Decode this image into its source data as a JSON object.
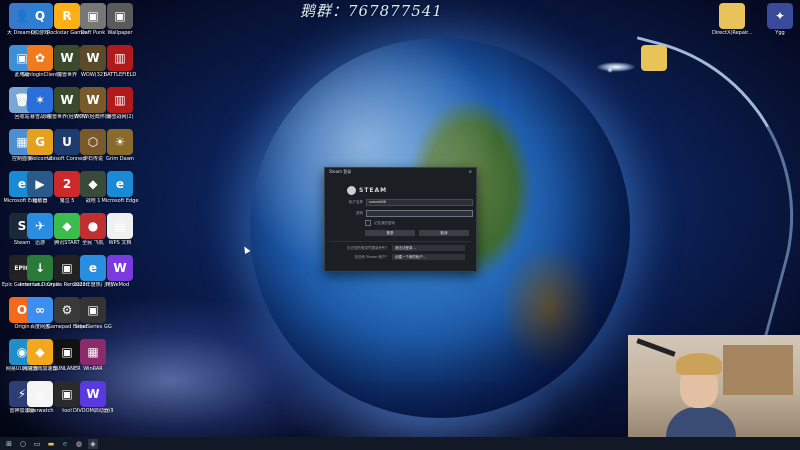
{
  "watermark": "鹅群：767877541",
  "desktop_icons_left": [
    {
      "label": "大 Dream(s)",
      "color": "#3a78c9",
      "glyph": "👤",
      "icon": "user-folder-icon"
    },
    {
      "label": "此电脑",
      "color": "#3f8fd8",
      "glyph": "▣",
      "icon": "computer-icon"
    },
    {
      "label": "回收站",
      "color": "#7aa6d6",
      "glyph": "🗑",
      "icon": "recycle-bin-icon"
    },
    {
      "label": "控制面板",
      "color": "#4d8fd0",
      "glyph": "▦",
      "icon": "control-panel-icon"
    },
    {
      "label": "Microsoft Edge",
      "color": "#1a8ad4",
      "glyph": "e",
      "icon": "edge-icon"
    },
    {
      "label": "Steam",
      "color": "#1b2838",
      "glyph": "S",
      "icon": "steam-icon"
    },
    {
      "label": "Epic Games Launcher",
      "color": "#222",
      "glyph": "EPIC",
      "icon": "epic-icon"
    },
    {
      "label": "Origin",
      "color": "#f26a1b",
      "glyph": "O",
      "icon": "origin-icon"
    },
    {
      "label": "网易UU加速器",
      "color": "#1f8ec9",
      "glyph": "◉",
      "icon": "uu-icon"
    },
    {
      "label": "雷神加速器",
      "color": "#2c3e73",
      "glyph": "⚡",
      "icon": "leishen-icon"
    }
  ],
  "desktop_icons_col2": [
    {
      "label": "QQ游戏",
      "color": "#2d7ed0",
      "glyph": "Q",
      "icon": "qq-game-icon"
    },
    {
      "label": "SunloginClient",
      "color": "#f07a1c",
      "glyph": "✿",
      "icon": "sunlogin-icon"
    },
    {
      "label": "暴雪战网",
      "color": "#2a6fd9",
      "glyph": "✶",
      "icon": "battlenet-icon"
    },
    {
      "label": "Welcome",
      "color": "#e5a020",
      "glyph": "G",
      "icon": "gog-icon"
    },
    {
      "label": "播放器",
      "color": "#2a5a8a",
      "glyph": "▶",
      "icon": "player-icon"
    },
    {
      "label": "迅游",
      "color": "#2a8ee0",
      "glyph": "✈",
      "icon": "xunyou-icon"
    },
    {
      "label": "Internet Downlo...",
      "color": "#2a7a3a",
      "glyph": "↓",
      "icon": "idm-icon"
    },
    {
      "label": "百度网盘",
      "color": "#3c8ff0",
      "glyph": "∞",
      "icon": "baidu-netdisk-icon"
    },
    {
      "label": "网易游戏加速器",
      "color": "#f4a71d",
      "glyph": "◆",
      "icon": "netease-boost-icon"
    },
    {
      "label": "Overwatch",
      "color": "#f5f5f5",
      "glyph": "◎",
      "icon": "overwatch-icon"
    }
  ],
  "desktop_icons_col3": [
    {
      "label": "Rockstar Games Launcher",
      "color": "#fcaf17",
      "glyph": "R",
      "icon": "rockstar-icon"
    },
    {
      "label": "魔兽世界",
      "color": "#3b4a2c",
      "glyph": "W",
      "icon": "wow-icon"
    },
    {
      "label": "魔兽世界(经典怀旧服)",
      "color": "#3b4a2c",
      "glyph": "W",
      "icon": "wow-classic-icon"
    },
    {
      "label": "Ubisoft Connect",
      "color": "#1e3b6e",
      "glyph": "U",
      "icon": "ubisoft-icon"
    },
    {
      "label": "鬼泣 5",
      "color": "#cc2a2a",
      "glyph": "2",
      "icon": "game-2-icon"
    },
    {
      "label": "腾讯START",
      "color": "#3dbb4f",
      "glyph": "◆",
      "icon": "start-icon"
    },
    {
      "label": "Crysis Remastered",
      "color": "#222",
      "glyph": "▣",
      "icon": "game-icon"
    },
    {
      "label": "Gamepad Helper",
      "color": "#3a3a3a",
      "glyph": "⚙",
      "icon": "gamepad-icon"
    },
    {
      "label": "SUNLANER",
      "color": "#111",
      "glyph": "▣",
      "icon": "sunlaner-icon"
    },
    {
      "label": "tool",
      "color": "#2a2a2a",
      "glyph": "▣",
      "icon": "tool-icon"
    }
  ],
  "desktop_icons_col4": [
    {
      "label": "Daft Punk",
      "color": "#777",
      "glyph": "▣",
      "icon": "photo-icon"
    },
    {
      "label": "WOW(32)",
      "color": "#5a4a2a",
      "glyph": "W",
      "icon": "wow-32-icon"
    },
    {
      "label": "WOW(经典怀旧)",
      "color": "#7a5a2a",
      "glyph": "W",
      "icon": "wow-classic-2-icon"
    },
    {
      "label": "炉石传说",
      "color": "#7a5a2a",
      "glyph": "⬡",
      "icon": "hearthstone-icon"
    },
    {
      "label": "战地 1",
      "color": "#3a4a3a",
      "glyph": "◆",
      "icon": "battlefield-icon"
    },
    {
      "label": "全民 飞机",
      "color": "#c03030",
      "glyph": "●",
      "icon": "game-3-icon"
    },
    {
      "label": "2023年度热门精选",
      "color": "#2a8ee0",
      "glyph": "e",
      "icon": "edge-2-icon"
    },
    {
      "label": "SteelSeries GG",
      "color": "#333",
      "glyph": "▣",
      "icon": "steelseries-icon"
    },
    {
      "label": "WinRAR",
      "color": "#8a2a6a",
      "glyph": "▦",
      "icon": "winrar-icon"
    },
    {
      "label": "DIVOOM启动器(新)",
      "color": "#5a3ae0",
      "glyph": "W",
      "icon": "wegame-icon"
    }
  ],
  "desktop_icons_col5": [
    {
      "label": "Wallpaper",
      "color": "#5a5a5a",
      "glyph": "▣",
      "icon": "wallpaper-icon"
    },
    {
      "label": "BATTLEFIELD",
      "color": "#b01a1a",
      "glyph": "▥",
      "icon": "battlefield-v-icon"
    },
    {
      "label": "暴雪战网(2)",
      "color": "#b01a1a",
      "glyph": "▥",
      "icon": "battlefield-2-icon"
    },
    {
      "label": "Grim Dawn",
      "color": "#8a6a2a",
      "glyph": "☀",
      "icon": "grim-dawn-icon"
    },
    {
      "label": "Microsoft Edge",
      "color": "#1a8ad4",
      "glyph": "e",
      "icon": "edge-3-icon"
    },
    {
      "label": "WPS 文档",
      "color": "#f0f0f0",
      "glyph": "▤",
      "icon": "document-icon"
    },
    {
      "label": "WeMod",
      "color": "#7a3ae0",
      "glyph": "W",
      "icon": "wemod-icon"
    }
  ],
  "desktop_icons_right": [
    {
      "label": "DirectX(Repair...",
      "color": "#e8c35a",
      "glyph": "",
      "icon": "folder-icon"
    },
    {
      "label": "Ygg",
      "color": "#3a4a9a",
      "glyph": "✦",
      "icon": "ygg-icon"
    }
  ],
  "steam_dialog": {
    "title": "Steam 登录",
    "brand": "STEAM",
    "account_label": "帐户名称",
    "account_value": "sneez086",
    "password_label": "密码",
    "password_value": "",
    "remember_label": "记住我的密码",
    "login_button": "登录",
    "cancel_button": "取消",
    "forgot_label": "忘记您的登录凭据或丢失？",
    "forgot_button": "我无法登录...",
    "new_label": "还没有 Steam 帐户？",
    "new_button": "创建一个新的帐户..."
  },
  "taskbar": {
    "items": [
      "start-icon",
      "search-icon",
      "task-view-icon",
      "file-explorer-icon",
      "edge-taskbar-icon",
      "steam-taskbar-icon",
      "active-app-icon"
    ]
  }
}
